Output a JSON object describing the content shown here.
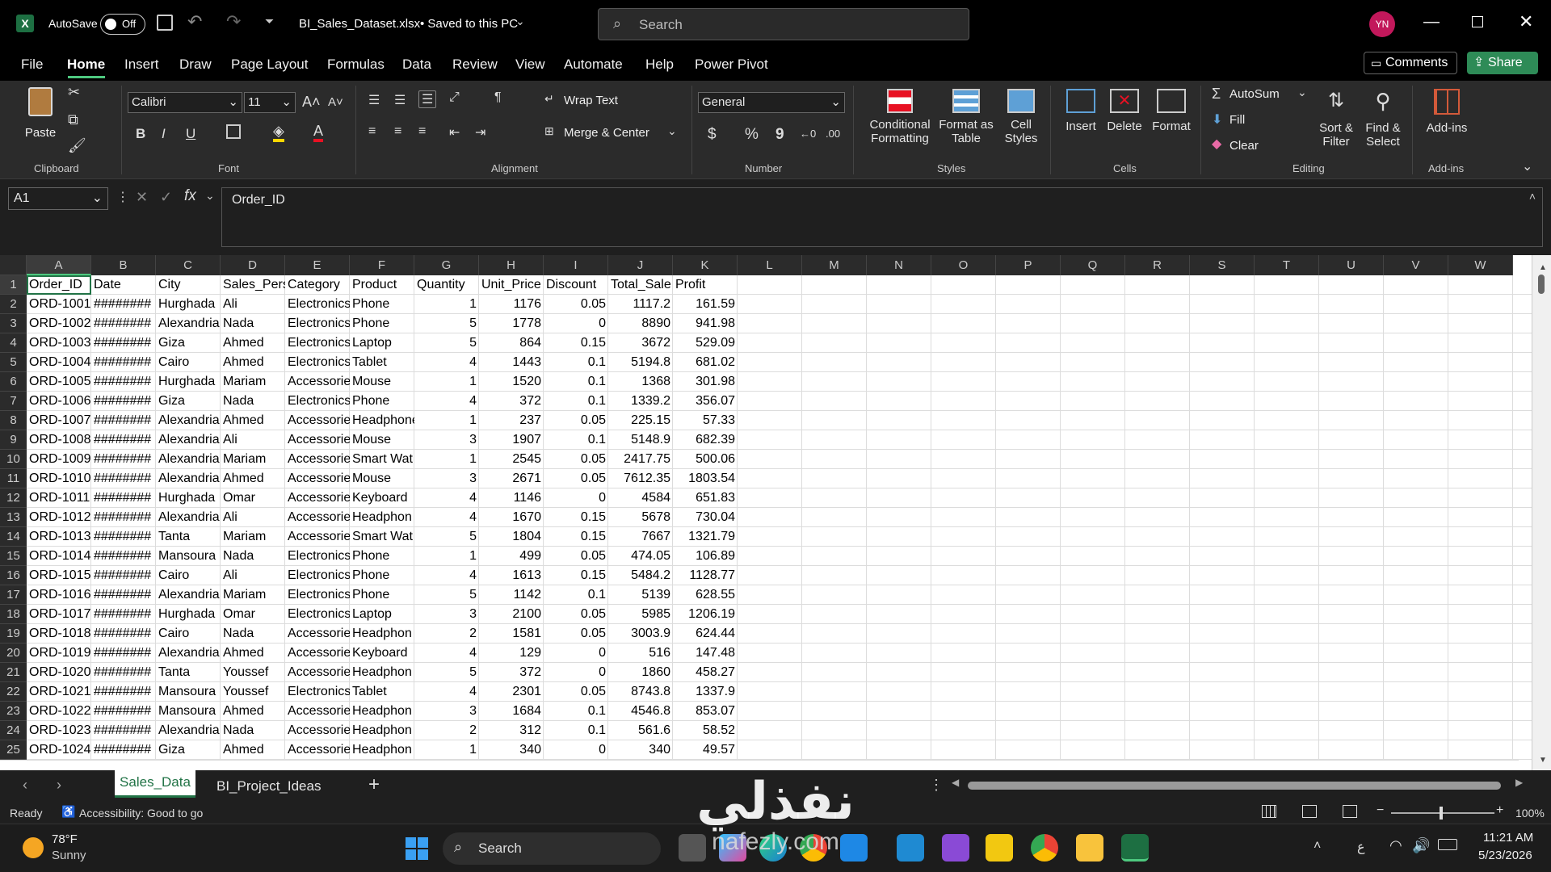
{
  "app": {
    "autosave_label": "AutoSave",
    "toggle_state": "Off",
    "filename": "BI_Sales_Dataset.xlsx",
    "saved_status": "• Saved to this PC",
    "search_placeholder": "Search",
    "user_initials": "YN"
  },
  "menu": {
    "items": [
      "File",
      "Home",
      "Insert",
      "Draw",
      "Page Layout",
      "Formulas",
      "Data",
      "Review",
      "View",
      "Automate",
      "Help",
      "Power Pivot"
    ],
    "comments": "Comments",
    "share": "Share"
  },
  "ribbon": {
    "clipboard": {
      "paste": "Paste",
      "group": "Clipboard"
    },
    "font": {
      "name": "Calibri",
      "size": "11",
      "group": "Font",
      "bold": "B",
      "italic": "I",
      "underline": "U"
    },
    "alignment": {
      "wrap": "Wrap Text",
      "merge": "Merge & Center",
      "group": "Alignment"
    },
    "number": {
      "format": "General",
      "currency": "$",
      "percent": "%",
      "comma": "9",
      "group": "Number"
    },
    "styles": {
      "conditional_1": "Conditional",
      "conditional_2": "Formatting",
      "format_table_1": "Format as",
      "format_table_2": "Table",
      "cell_styles_1": "Cell",
      "cell_styles_2": "Styles",
      "group": "Styles"
    },
    "cells": {
      "insert": "Insert",
      "delete": "Delete",
      "format": "Format",
      "group": "Cells"
    },
    "editing": {
      "autosum": "AutoSum",
      "fill": "Fill",
      "clear": "Clear",
      "sort_1": "Sort &",
      "sort_2": "Filter",
      "find_1": "Find &",
      "find_2": "Select",
      "group": "Editing"
    },
    "addins": {
      "label": "Add-ins",
      "group": "Add-ins"
    }
  },
  "formula": {
    "name_box": "A1",
    "content": "Order_ID"
  },
  "columns": [
    "A",
    "B",
    "C",
    "D",
    "E",
    "F",
    "G",
    "H",
    "I",
    "J",
    "K",
    "L",
    "M",
    "N",
    "O",
    "P",
    "Q",
    "R",
    "S",
    "T",
    "U",
    "V",
    "W"
  ],
  "rows": [
    [
      "Order_ID",
      "Date",
      "City",
      "Sales_Pers",
      "Category",
      "Product",
      "Quantity",
      "Unit_Price",
      "Discount",
      "Total_Sale",
      "Profit"
    ],
    [
      "ORD-1001",
      "########",
      "Hurghada",
      "Ali",
      "Electronics",
      "Phone",
      "1",
      "1176",
      "0.05",
      "1117.2",
      "161.59"
    ],
    [
      "ORD-1002",
      "########",
      "Alexandria",
      "Nada",
      "Electronics",
      "Phone",
      "5",
      "1778",
      "0",
      "8890",
      "941.98"
    ],
    [
      "ORD-1003",
      "########",
      "Giza",
      "Ahmed",
      "Electronics",
      "Laptop",
      "5",
      "864",
      "0.15",
      "3672",
      "529.09"
    ],
    [
      "ORD-1004",
      "########",
      "Cairo",
      "Ahmed",
      "Electronics",
      "Tablet",
      "4",
      "1443",
      "0.1",
      "5194.8",
      "681.02"
    ],
    [
      "ORD-1005",
      "########",
      "Hurghada",
      "Mariam",
      "Accessories",
      "Mouse",
      "1",
      "1520",
      "0.1",
      "1368",
      "301.98"
    ],
    [
      "ORD-1006",
      "########",
      "Giza",
      "Nada",
      "Electronics",
      "Phone",
      "4",
      "372",
      "0.1",
      "1339.2",
      "356.07"
    ],
    [
      "ORD-1007",
      "########",
      "Alexandria",
      "Ahmed",
      "Accessories",
      "Headphone",
      "1",
      "237",
      "0.05",
      "225.15",
      "57.33"
    ],
    [
      "ORD-1008",
      "########",
      "Alexandria",
      "Ali",
      "Accessories",
      "Mouse",
      "3",
      "1907",
      "0.1",
      "5148.9",
      "682.39"
    ],
    [
      "ORD-1009",
      "########",
      "Alexandria",
      "Mariam",
      "Accessories",
      "Smart Wat",
      "1",
      "2545",
      "0.05",
      "2417.75",
      "500.06"
    ],
    [
      "ORD-1010",
      "########",
      "Alexandria",
      "Ahmed",
      "Accessories",
      "Mouse",
      "3",
      "2671",
      "0.05",
      "7612.35",
      "1803.54"
    ],
    [
      "ORD-1011",
      "########",
      "Hurghada",
      "Omar",
      "Accessories",
      "Keyboard",
      "4",
      "1146",
      "0",
      "4584",
      "651.83"
    ],
    [
      "ORD-1012",
      "########",
      "Alexandria",
      "Ali",
      "Accessories",
      "Headphon",
      "4",
      "1670",
      "0.15",
      "5678",
      "730.04"
    ],
    [
      "ORD-1013",
      "########",
      "Tanta",
      "Mariam",
      "Accessories",
      "Smart Wat",
      "5",
      "1804",
      "0.15",
      "7667",
      "1321.79"
    ],
    [
      "ORD-1014",
      "########",
      "Mansoura",
      "Nada",
      "Electronics",
      "Phone",
      "1",
      "499",
      "0.05",
      "474.05",
      "106.89"
    ],
    [
      "ORD-1015",
      "########",
      "Cairo",
      "Ali",
      "Electronics",
      "Phone",
      "4",
      "1613",
      "0.15",
      "5484.2",
      "1128.77"
    ],
    [
      "ORD-1016",
      "########",
      "Alexandria",
      "Mariam",
      "Electronics",
      "Phone",
      "5",
      "1142",
      "0.1",
      "5139",
      "628.55"
    ],
    [
      "ORD-1017",
      "########",
      "Hurghada",
      "Omar",
      "Electronics",
      "Laptop",
      "3",
      "2100",
      "0.05",
      "5985",
      "1206.19"
    ],
    [
      "ORD-1018",
      "########",
      "Cairo",
      "Nada",
      "Accessories",
      "Headphon",
      "2",
      "1581",
      "0.05",
      "3003.9",
      "624.44"
    ],
    [
      "ORD-1019",
      "########",
      "Alexandria",
      "Ahmed",
      "Accessories",
      "Keyboard",
      "4",
      "129",
      "0",
      "516",
      "147.48"
    ],
    [
      "ORD-1020",
      "########",
      "Tanta",
      "Youssef",
      "Accessories",
      "Headphon",
      "5",
      "372",
      "0",
      "1860",
      "458.27"
    ],
    [
      "ORD-1021",
      "########",
      "Mansoura",
      "Youssef",
      "Electronics",
      "Tablet",
      "4",
      "2301",
      "0.05",
      "8743.8",
      "1337.9"
    ],
    [
      "ORD-1022",
      "########",
      "Mansoura",
      "Ahmed",
      "Accessories",
      "Headphon",
      "3",
      "1684",
      "0.1",
      "4546.8",
      "853.07"
    ],
    [
      "ORD-1023",
      "########",
      "Alexandria",
      "Nada",
      "Accessories",
      "Headphon",
      "2",
      "312",
      "0.1",
      "561.6",
      "58.52"
    ],
    [
      "ORD-1024",
      "########",
      "Giza",
      "Ahmed",
      "Accessories",
      "Headphon",
      "1",
      "340",
      "0",
      "340",
      "49.57"
    ]
  ],
  "sheets": {
    "active": "Sales_Data",
    "other": "BI_Project_Ideas"
  },
  "status": {
    "ready": "Ready",
    "accessibility": "Accessibility: Good to go",
    "zoom": "100%"
  },
  "taskbar": {
    "temp": "78°F",
    "weather": "Sunny",
    "search": "Search",
    "time": "11:21 AM",
    "date": "5/23/2026",
    "lang": "ع"
  },
  "watermark": {
    "arabic": "نفذلي",
    "latin": "nafezly.com"
  }
}
